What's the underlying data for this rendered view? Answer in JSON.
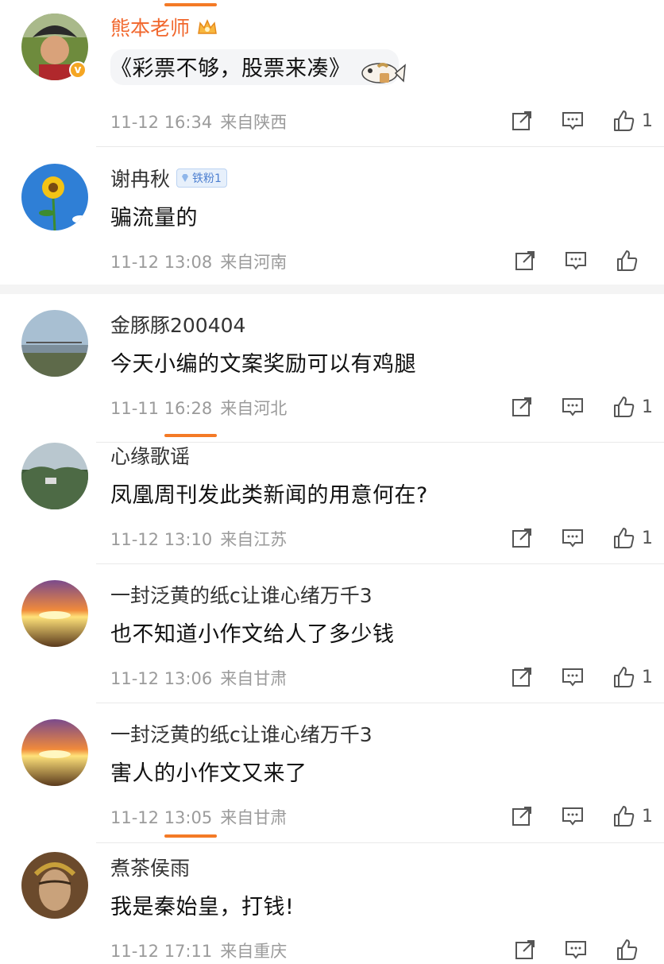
{
  "comments": [
    {
      "username": "熊本老师",
      "text": "《彩票不够，股票来凑》",
      "date": "11-12 16:34",
      "location": "来自陕西",
      "likes": "1"
    },
    {
      "username": "谢冉秋",
      "badge": "铁粉1",
      "text": "骗流量的",
      "date": "11-12 13:08",
      "location": "来自河南",
      "likes": ""
    },
    {
      "username": "金豚豚200404",
      "text": "今天小编的文案奖励可以有鸡腿",
      "date": "11-11 16:28",
      "location": "来自河北",
      "likes": "1"
    },
    {
      "username": "心缘歌谣",
      "text": "凤凰周刊发此类新闻的用意何在?",
      "date": "11-12 13:10",
      "location": "来自江苏",
      "likes": "1"
    },
    {
      "username": "一封泛黄的纸c让谁心绪万千3",
      "text": "也不知道小作文给人了多少钱",
      "date": "11-12 13:06",
      "location": "来自甘肃",
      "likes": "1"
    },
    {
      "username": "一封泛黄的纸c让谁心绪万千3",
      "text": "害人的小作文又来了",
      "date": "11-12 13:05",
      "location": "来自甘肃",
      "likes": "1"
    },
    {
      "username": "煮茶侯雨",
      "text": "我是秦始皇，打钱!",
      "date": "11-12 17:11",
      "location": "来自重庆",
      "likes": ""
    }
  ],
  "icons": {
    "share": "share-icon",
    "comment": "comment-icon",
    "like": "thumbs-up-icon"
  },
  "colors": {
    "vip_name": "#f1672d",
    "accent_tab": "#f47a26",
    "meta_text": "#9b9b9b"
  }
}
